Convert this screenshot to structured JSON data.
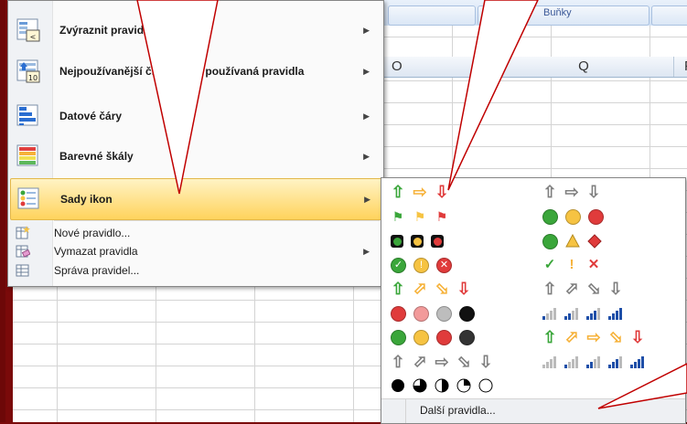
{
  "ribbon": {
    "group_label": "Buňky"
  },
  "columns": [
    "O",
    "Q",
    "F"
  ],
  "menu": {
    "items": [
      {
        "label": "Zvýraznit pravidla buněk",
        "icon": "highlight-cells-rules-icon"
      },
      {
        "label": "Nejpoužívanější či nejméně používaná pravidla",
        "icon": "top-bottom-rules-icon"
      },
      {
        "label": "Datové čáry",
        "icon": "data-bars-icon"
      },
      {
        "label": "Barevné škály",
        "icon": "color-scales-icon"
      },
      {
        "label": "Sady ikon",
        "icon": "icon-sets-icon"
      }
    ],
    "small_items": [
      {
        "label": "Nové pravidlo...",
        "icon": "new-rule-icon"
      },
      {
        "label": "Vymazat pravidla",
        "icon": "clear-rules-icon"
      },
      {
        "label": "Správa pravidel...",
        "icon": "manage-rules-icon"
      }
    ]
  },
  "submenu": {
    "more_rules": "Další pravidla..."
  },
  "colors": {
    "highlight": "#ffd35c",
    "green": "#3aa63a",
    "yellow": "#f6c342",
    "red": "#e03b3b",
    "gray": "#8c8c8c",
    "signal_on": "#1f4fa8",
    "background_frame": "#7a0a0a"
  }
}
